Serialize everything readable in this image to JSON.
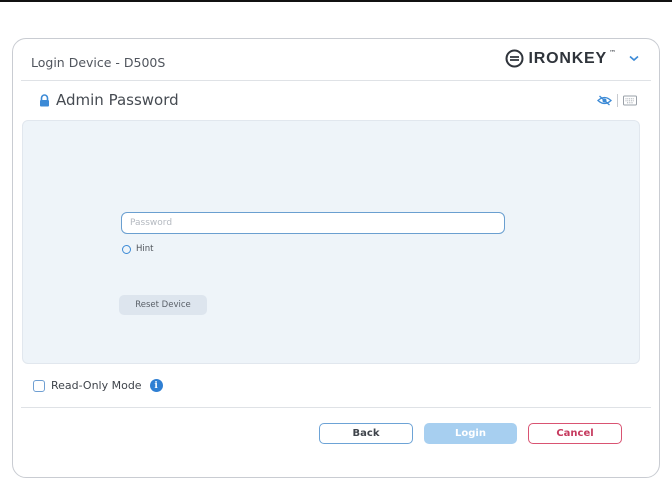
{
  "window": {
    "title": "Login Device - D500S",
    "brand": "IRONKEY",
    "brand_tm": "™"
  },
  "section": {
    "title": "Admin Password"
  },
  "form": {
    "password_placeholder": "Password",
    "password_value": "",
    "hint_label": "Hint",
    "reset_label": "Reset Device",
    "read_only_label": "Read-Only Mode",
    "read_only_checked": false
  },
  "buttons": {
    "back": "Back",
    "login": "Login",
    "cancel": "Cancel"
  },
  "colors": {
    "accent_blue": "#2f7fd3",
    "login_disabled": "#a7cff0",
    "cancel_red": "#d95372",
    "panel_bg": "#eef4f9"
  },
  "icons": {
    "brand": "ironkey-logo-icon",
    "menu": "chevron-down-icon",
    "lock": "lock-icon",
    "visibility": "eye-slash-icon",
    "keyboard": "keyboard-icon",
    "info": "info-icon"
  }
}
